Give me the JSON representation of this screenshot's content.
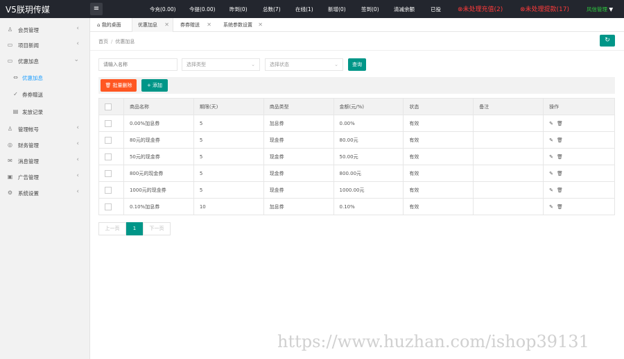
{
  "app": {
    "title": "V5朕玥传媒"
  },
  "topbar": {
    "stats": [
      {
        "label": "今充(0.00)"
      },
      {
        "label": "今提(0.00)"
      },
      {
        "label": "昨到(0)"
      },
      {
        "label": "总数(7)"
      },
      {
        "label": "在线(1)"
      },
      {
        "label": "新增(0)"
      },
      {
        "label": "签到(0)"
      },
      {
        "label": "清减余额"
      },
      {
        "label": "已投"
      }
    ],
    "alert_recharge": "⊗未处理充值(2)",
    "alert_withdraw": "⊗未处理提款(17)",
    "user": "风信管理",
    "user_caret": "▼",
    "menu_icon": "≡"
  },
  "sidebar": {
    "items": [
      {
        "label": "会员管理",
        "icon": "user-icon",
        "glyph": "♙",
        "arrow": "‹"
      },
      {
        "label": "项目新闻",
        "icon": "news-icon",
        "glyph": "▭",
        "arrow": "‹"
      },
      {
        "label": "优惠加息",
        "icon": "coupon-icon",
        "glyph": "▭",
        "arrow": "⌄"
      },
      {
        "label": "优惠加息",
        "icon": "discount-icon",
        "glyph": "⇔",
        "arrow": "",
        "sub": true,
        "active": true
      },
      {
        "label": "券券赠送",
        "icon": "gift-icon",
        "glyph": "✓",
        "arrow": "",
        "sub": true
      },
      {
        "label": "发放记录",
        "icon": "record-icon",
        "glyph": "▤",
        "arrow": "",
        "sub": true
      },
      {
        "label": "管理帐号",
        "icon": "account-icon",
        "glyph": "♙",
        "arrow": "‹"
      },
      {
        "label": "财务管理",
        "icon": "finance-icon",
        "glyph": "◎",
        "arrow": "‹"
      },
      {
        "label": "消息管理",
        "icon": "message-icon",
        "glyph": "✉",
        "arrow": "‹"
      },
      {
        "label": "广告管理",
        "icon": "ad-icon",
        "glyph": "▣",
        "arrow": "‹"
      },
      {
        "label": "系统设置",
        "icon": "settings-icon",
        "glyph": "⚙",
        "arrow": "‹"
      }
    ]
  },
  "tabs": [
    {
      "label": "我的桌面",
      "icon": "⌂",
      "closable": false,
      "active": false
    },
    {
      "label": "优惠加息",
      "closable": true,
      "active": true
    },
    {
      "label": "券券赠送",
      "closable": true,
      "active": false
    },
    {
      "label": "系统参数设置",
      "closable": true,
      "active": false
    }
  ],
  "tab_close": "✕",
  "breadcrumb": {
    "home": "首页",
    "separator": "/",
    "current": "优惠加息"
  },
  "refresh_icon": "↻",
  "filters": {
    "name_placeholder": "请输入名称",
    "type_placeholder": "选择类型",
    "status_placeholder": "选择状态",
    "caret": "⌄",
    "query": "查询"
  },
  "actions": {
    "batch_delete": "🗑 批量删除",
    "add": "+ 添加"
  },
  "table": {
    "headers": [
      "商品名称",
      "期限(天)",
      "商品类型",
      "金额(元/%)",
      "状态",
      "备注",
      "操作"
    ],
    "rows": [
      {
        "name": "0.00%加息券",
        "term": "5",
        "type": "加息券",
        "amount": "0.00%",
        "status": "有效",
        "note": ""
      },
      {
        "name": "80元的现金券",
        "term": "5",
        "type": "现金券",
        "amount": "80.00元",
        "status": "有效",
        "note": ""
      },
      {
        "name": "50元的现金券",
        "term": "5",
        "type": "现金券",
        "amount": "50.00元",
        "status": "有效",
        "note": ""
      },
      {
        "name": "800元的现金券",
        "term": "5",
        "type": "现金券",
        "amount": "800.00元",
        "status": "有效",
        "note": ""
      },
      {
        "name": "1000元的现金券",
        "term": "5",
        "type": "现金券",
        "amount": "1000.00元",
        "status": "有效",
        "note": ""
      },
      {
        "name": "0.10%加息券",
        "term": "10",
        "type": "加息券",
        "amount": "0.10%",
        "status": "有效",
        "note": ""
      }
    ],
    "edit_icon": "✎",
    "delete_icon": "🗑"
  },
  "pager": {
    "prev": "上一页",
    "current": "1",
    "next": "下一页"
  },
  "watermark": "https://www.huzhan.com/ishop39131"
}
